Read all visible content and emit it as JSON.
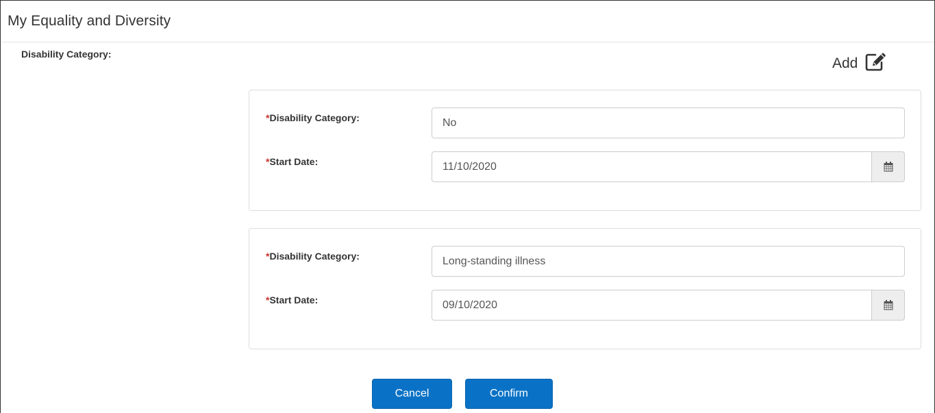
{
  "header": {
    "title": "My Equality and Diversity"
  },
  "section": {
    "label": "Disability Category:",
    "add_label": "Add",
    "add_icon": "edit-icon"
  },
  "records": [
    {
      "required_marker": "*",
      "category_label": "Disability Category:",
      "category_value": "No",
      "start_date_label": "Start Date:",
      "start_date_value": "11/10/2020",
      "calendar_icon": "calendar-icon"
    },
    {
      "required_marker": "*",
      "category_label": "Disability Category:",
      "category_value": "Long-standing illness",
      "start_date_label": "Start Date:",
      "start_date_value": "09/10/2020",
      "calendar_icon": "calendar-icon"
    }
  ],
  "actions": {
    "cancel_label": "Cancel",
    "confirm_label": "Confirm"
  },
  "colors": {
    "primary": "#0a72c6",
    "required": "#c9302c",
    "border": "#cccccc",
    "addon_bg": "#eeeeee"
  }
}
